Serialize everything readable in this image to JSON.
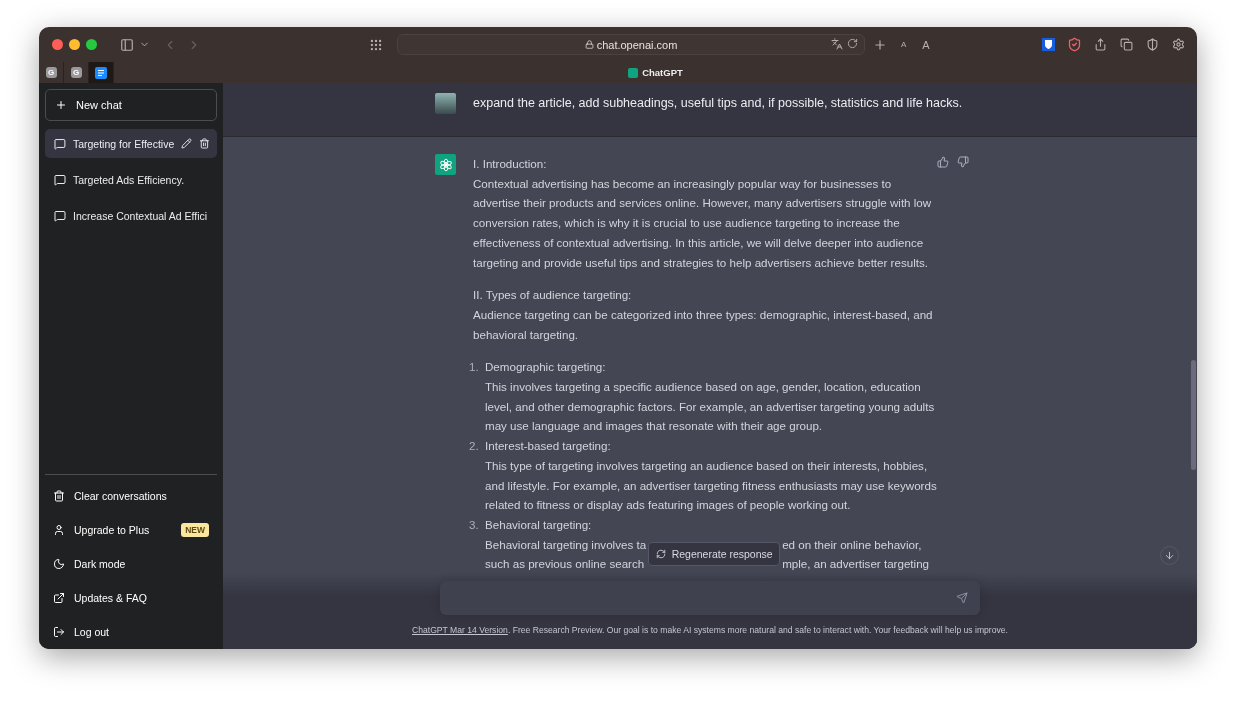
{
  "browser": {
    "url": "chat.openai.com",
    "page_title": "ChatGPT",
    "text_smaller": "A",
    "text_larger": "A",
    "pinned_tabs": [
      {
        "kind": "letter",
        "letter": "G",
        "selected": false
      },
      {
        "kind": "letter",
        "letter": "G",
        "selected": false
      },
      {
        "kind": "doc",
        "selected": true
      }
    ]
  },
  "sidebar": {
    "new_chat": "New chat",
    "conversations": [
      {
        "title": "Targeting for Effective",
        "selected": true
      },
      {
        "title": "Targeted Ads Efficiency.",
        "selected": false
      },
      {
        "title": "Increase Contextual Ad Effici",
        "selected": false
      }
    ],
    "menu": [
      {
        "kind": "trash",
        "label": "Clear conversations"
      },
      {
        "kind": "user",
        "label": "Upgrade to Plus",
        "badge": "NEW"
      },
      {
        "kind": "moon",
        "label": "Dark mode"
      },
      {
        "kind": "external",
        "label": "Updates & FAQ"
      },
      {
        "kind": "logout",
        "label": "Log out"
      }
    ]
  },
  "chat": {
    "user_message": "expand the article, add subheadings, useful tips and, if possible, statistics and life hacks.",
    "response": [
      {
        "kind": "paragraph",
        "heading": "I. Introduction:",
        "text": "Contextual advertising has become an increasingly popular way for businesses to advertise their products and services online. However, many advertisers struggle with low conversion rates, which is why it is crucial to use audience targeting to increase the effectiveness of contextual advertising. In this article, we will delve deeper into audience targeting and provide useful tips and strategies to help advertisers achieve better results."
      },
      {
        "kind": "paragraph",
        "heading": "II. Types of audience targeting:",
        "text": "Audience targeting can be categorized into three types: demographic, interest-based, and behavioral targeting."
      },
      {
        "kind": "list",
        "items": [
          {
            "number": "1.",
            "title": "Demographic targeting:",
            "text": "This involves targeting a specific audience based on age, gender, location, education level, and other demographic factors. For example, an advertiser targeting young adults may use language and images that resonate with their age group."
          },
          {
            "number": "2.",
            "title": "Interest-based targeting:",
            "text": "This type of targeting involves targeting an audience based on their interests, hobbies, and lifestyle. For example, an advertiser targeting fitness enthusiasts may use keywords related to fitness or display ads featuring images of people working out."
          },
          {
            "number": "3.",
            "title": "Behavioral targeting:",
            "fragments": [
              [
                "Behavioral targeting involves ta",
                "ed on their online behavior,"
              ],
              [
                "such as previous online search",
                "mple, an advertiser targeting"
              ]
            ]
          }
        ]
      }
    ],
    "regenerate": "Regenerate response",
    "footer": {
      "link": "ChatGPT Mar 14 Version",
      "text": ". Free Research Preview. Our goal is to make AI systems more natural and safe to interact with. Your feedback will help us improve."
    }
  }
}
